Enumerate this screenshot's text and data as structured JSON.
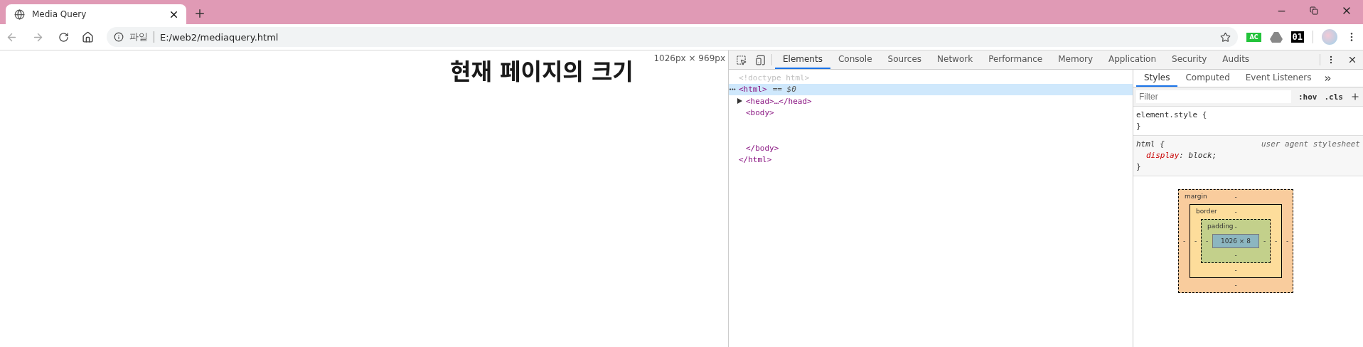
{
  "browser_tab": {
    "title": "Media Query"
  },
  "address_bar": {
    "scheme_label": "파일",
    "url": "E:/web2/mediaquery.html"
  },
  "extensions": [
    {
      "kind": "badge",
      "text": "AC",
      "color": "#22c33a"
    },
    {
      "kind": "drive"
    },
    {
      "kind": "tile",
      "text": "01",
      "color": "#000000"
    }
  ],
  "page": {
    "heading": "현재 페이지의 크기",
    "size_overlay": "1026px × 969px"
  },
  "devtools": {
    "tabs": [
      {
        "label": "Elements",
        "selected": true
      },
      {
        "label": "Console",
        "selected": false
      },
      {
        "label": "Sources",
        "selected": false
      },
      {
        "label": "Network",
        "selected": false
      },
      {
        "label": "Performance",
        "selected": false
      },
      {
        "label": "Memory",
        "selected": false
      },
      {
        "label": "Application",
        "selected": false
      },
      {
        "label": "Security",
        "selected": false
      },
      {
        "label": "Audits",
        "selected": false
      }
    ],
    "dom": [
      {
        "kind": "doctype",
        "open": "<!doctype html>",
        "selected": false
      },
      {
        "kind": "element",
        "marker": "•••",
        "open": "<html>",
        "suffix": "== $0",
        "close": "</html>",
        "selected": true,
        "children": [
          {
            "open": "<head>",
            "ellipsis": "…",
            "close": "</head>",
            "expanded": false,
            "selected": false
          },
          {
            "open": "<body>",
            "close": "</body>",
            "selected": false
          }
        ]
      }
    ],
    "sidebar_tabs": [
      {
        "label": "Styles",
        "selected": true
      },
      {
        "label": "Computed",
        "selected": false
      },
      {
        "label": "Event Listeners",
        "selected": false
      }
    ],
    "filter": {
      "placeholder": "Filter"
    },
    "filter_buttons": [
      ":hov",
      ".cls"
    ],
    "rules": [
      {
        "selector": "element.style",
        "open": "{",
        "close": "}"
      },
      {
        "selector": "html",
        "open": "{",
        "close": "}",
        "source": "user agent stylesheet",
        "declarations": [
          {
            "property": "display",
            "separator": ":",
            "value": "block;"
          }
        ]
      }
    ],
    "box_model": {
      "margin": {
        "label": "margin",
        "top": "-",
        "right": "-",
        "bottom": "-",
        "left": "-"
      },
      "border": {
        "label": "border",
        "top": "-",
        "right": "-",
        "bottom": "-",
        "left": "-"
      },
      "padding": {
        "label": "padding",
        "top": "-",
        "right": "-",
        "bottom": "-",
        "left": "-"
      },
      "content": "1026 × 8"
    }
  }
}
